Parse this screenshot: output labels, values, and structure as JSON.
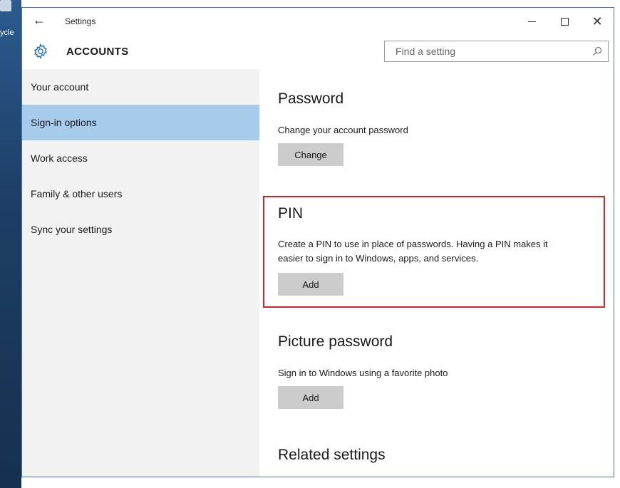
{
  "desktop": {
    "recycle_label": "ycle"
  },
  "window": {
    "app_title": "Settings",
    "back_glyph": "←",
    "controls": {
      "minimize": "minimize-icon",
      "maximize": "maximize-icon",
      "close": "✕"
    }
  },
  "header": {
    "icon": "gear-icon",
    "title": "ACCOUNTS",
    "search_placeholder": "Find a setting",
    "search_icon": "search-icon"
  },
  "sidebar": {
    "items": [
      {
        "label": "Your account",
        "selected": false
      },
      {
        "label": "Sign-in options",
        "selected": true
      },
      {
        "label": "Work access",
        "selected": false
      },
      {
        "label": "Family & other users",
        "selected": false
      },
      {
        "label": "Sync your settings",
        "selected": false
      }
    ],
    "selected_color": "#a6cbeb"
  },
  "content": {
    "password": {
      "heading": "Password",
      "description": "Change your account password",
      "button": "Change"
    },
    "pin": {
      "heading": "PIN",
      "description_line1": "Create a PIN to use in place of passwords. Having a PIN makes it",
      "description_line2": "easier to sign in to Windows, apps, and services.",
      "button": "Add",
      "highlight_color": "#d4232a"
    },
    "picture_password": {
      "heading": "Picture password",
      "description": "Sign in to Windows using a favorite photo",
      "button": "Add"
    },
    "related": {
      "heading": "Related settings"
    }
  }
}
